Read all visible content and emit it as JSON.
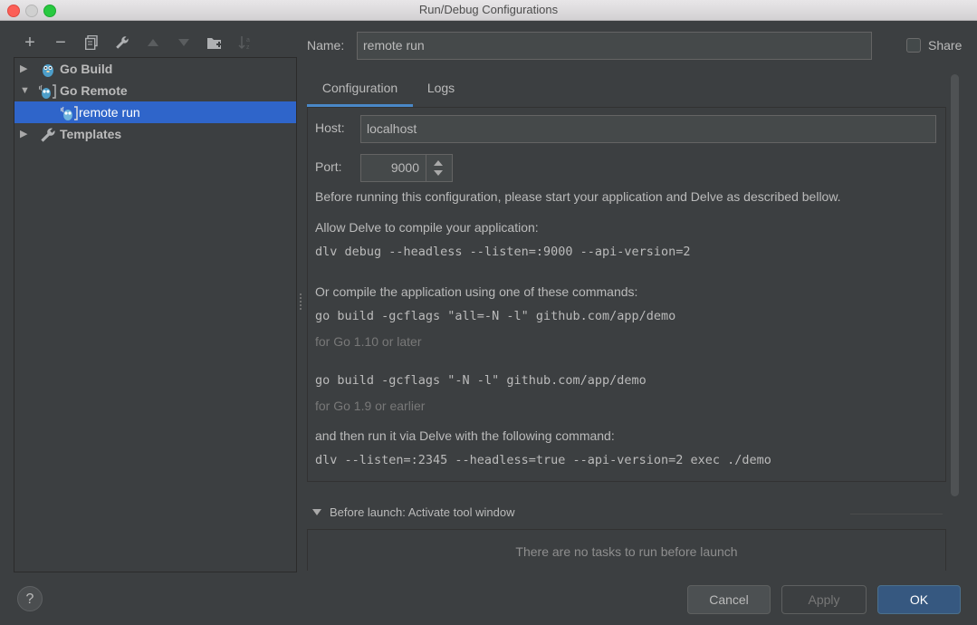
{
  "window": {
    "title": "Run/Debug Configurations"
  },
  "toolbar": {
    "add": "+",
    "remove": "−",
    "copy": "⧉",
    "edit": "🔧",
    "up": "▲",
    "down": "▼",
    "folder": "📁",
    "sort": "↓ᵃ"
  },
  "tree": {
    "items": [
      {
        "label": "Go Build",
        "expanded": false
      },
      {
        "label": "Go Remote",
        "expanded": true
      },
      {
        "label": "remote run",
        "selected": true
      },
      {
        "label": "Templates",
        "expanded": false
      }
    ]
  },
  "form": {
    "name_label": "Name:",
    "name_value": "remote run",
    "share_label": "Share"
  },
  "tabs": [
    {
      "label": "Configuration",
      "active": true
    },
    {
      "label": "Logs",
      "active": false
    }
  ],
  "config": {
    "host_label": "Host:",
    "host_value": "localhost",
    "port_label": "Port:",
    "port_value": "9000",
    "intro": "Before running this configuration, please start your application and Delve as described bellow.",
    "allow_title": "Allow Delve to compile your application:",
    "allow_cmd": "dlv debug --headless --listen=:9000 --api-version=2",
    "or_title": "Or compile the application using one of these commands:",
    "cmd_new": "go build -gcflags \"all=-N -l\" github.com/app/demo",
    "hint_new": "for Go 1.10 or later",
    "cmd_old": "go build -gcflags \"-N -l\" github.com/app/demo",
    "hint_old": "for Go 1.9 or earlier",
    "then_title": "and then run it via Delve with the following command:",
    "then_cmd": "dlv --listen=:2345 --headless=true --api-version=2 exec ./demo"
  },
  "before_launch": {
    "label": "Before launch: Activate tool window",
    "empty": "There are no tasks to run before launch"
  },
  "buttons": {
    "help": "?",
    "cancel": "Cancel",
    "apply": "Apply",
    "ok": "OK"
  },
  "colors": {
    "accent": "#2f65ca",
    "tab_underline": "#4a88c7",
    "ok_button": "#365880"
  }
}
